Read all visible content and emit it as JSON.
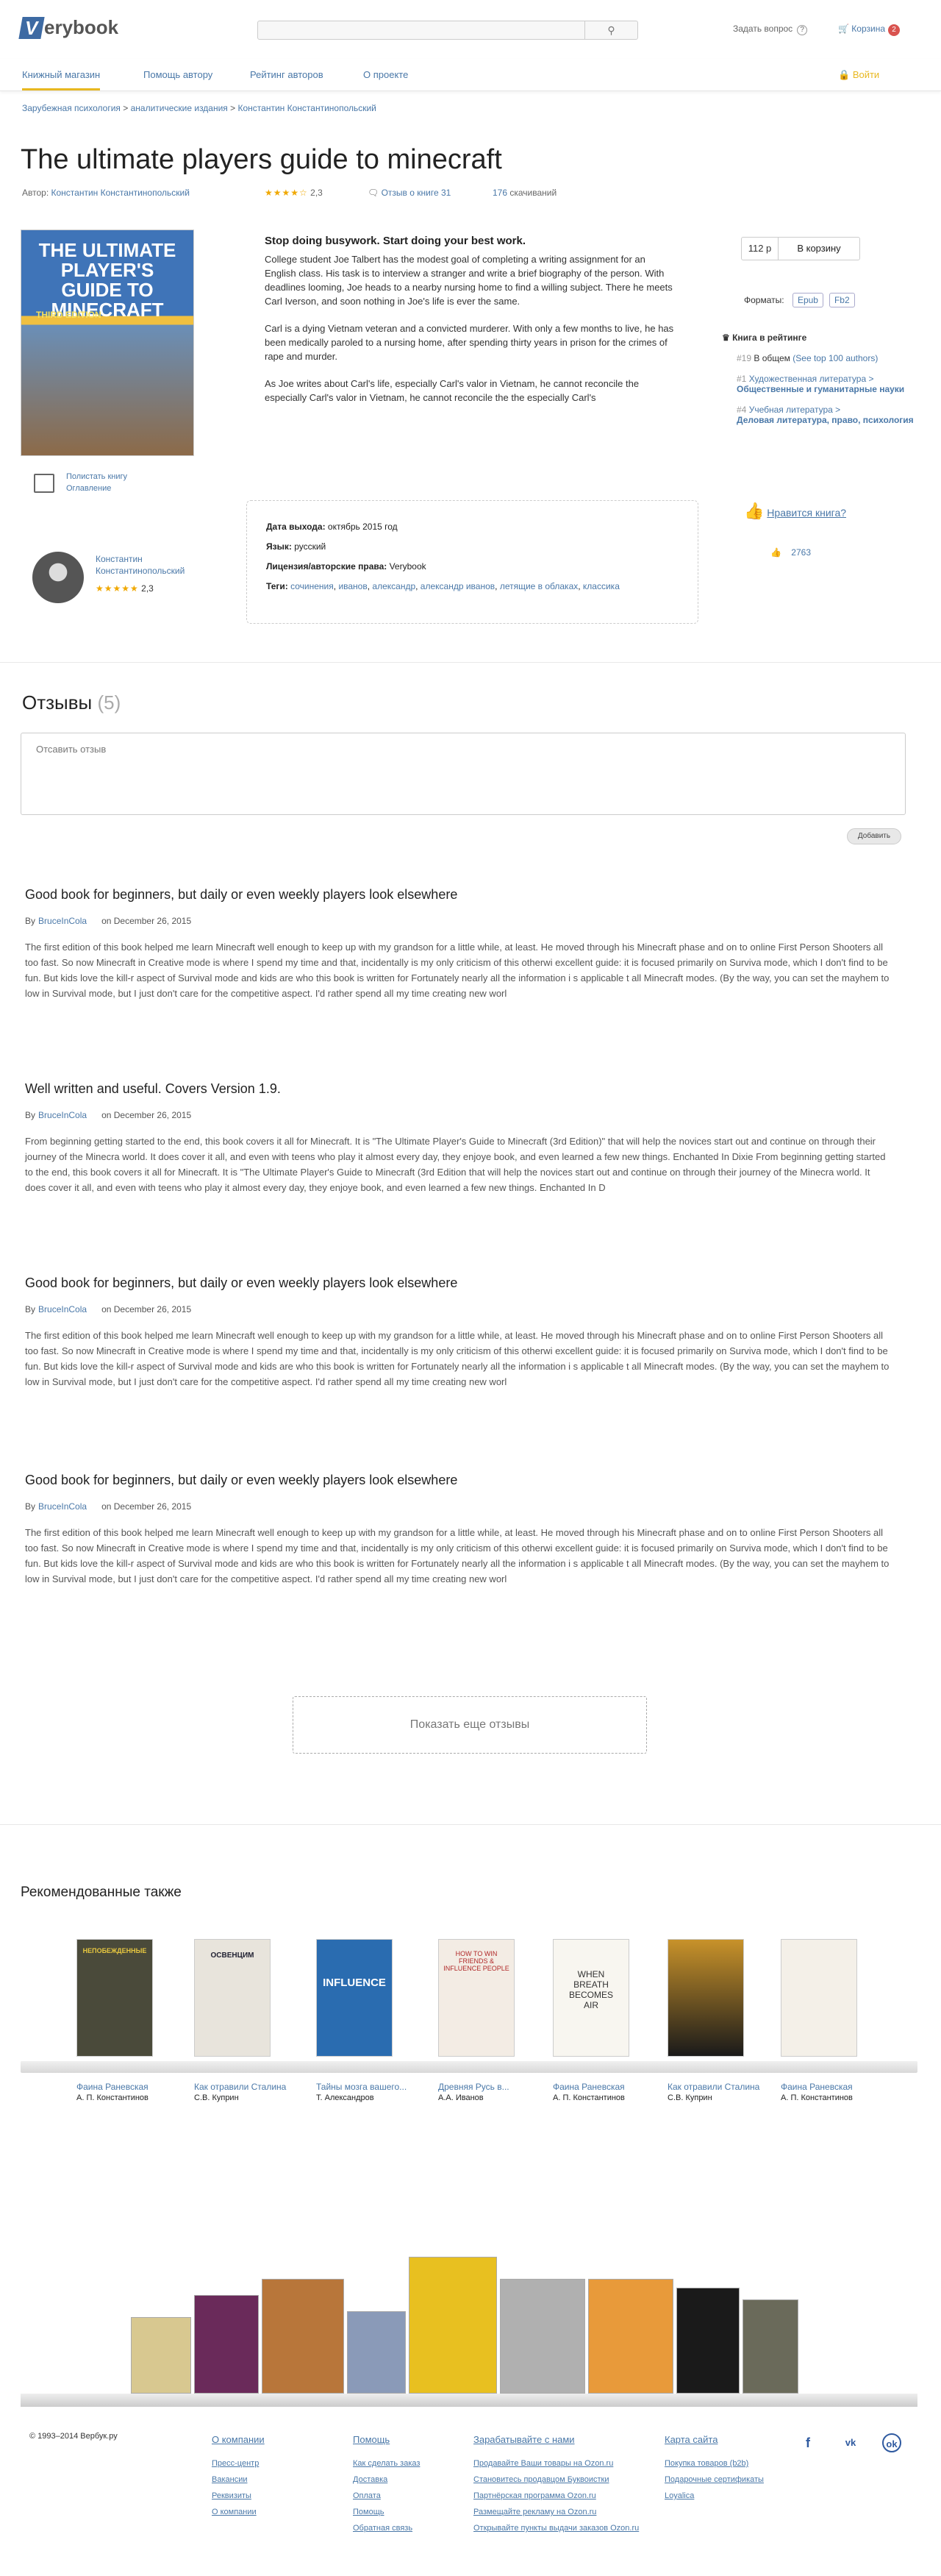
{
  "header": {
    "logo": "erybook",
    "search_icon": "search-icon",
    "ask": "Задать вопрос",
    "cart": "Корзина",
    "cart_count": "2"
  },
  "nav": {
    "items": [
      "Книжный магазин",
      "Помощь автору",
      "Рейтинг авторов",
      "О проекте"
    ],
    "login": "Войти"
  },
  "breadcrumb": [
    "Зарубежная психология",
    "аналитические издания",
    "Константин Константинопольский"
  ],
  "book": {
    "title": "The ultimate players guide to minecraft",
    "author_label": "Автор:",
    "author": "Константин Константинопольский",
    "rating": "2,3",
    "reviews": "Отзыв о книге 31",
    "downloads_n": "176",
    "downloads": "скачиваний",
    "cover_title": "THE ULTIMATE PLAYER'S GUIDE TO MINECRAFT",
    "cover_edition": "THIRD EDITION",
    "read_link": "Полистать книгу",
    "toc_link": "Оглавление",
    "author_name": "Константин Константинопольский",
    "author_rating": "2,3",
    "lead": "Stop doing busywork. Start doing your best work.",
    "p1": "College student Joe Talbert has the modest goal of completing a writing assignment for an English class. His task is to interview a stranger and write a brief biography of the person. With deadlines looming, Joe heads to a nearby nursing home to find a willing subject. There he meets Carl Iverson, and soon nothing in Joe's life is ever the same.",
    "p2": "Carl is a dying Vietnam veteran and a convicted murderer. With only a few months to live, he has been medically paroled to a nursing home, after spending thirty years in prison for the crimes of rape and murder.",
    "p3": "As Joe writes about Carl's life, especially Carl's valor in Vietnam, he cannot reconcile the especially Carl's valor in Vietnam, he cannot reconcile the the especially Carl's",
    "release_label": "Дата выхода:",
    "release": "октябрь 2015 год",
    "lang_label": "Язык:",
    "lang": "русский",
    "license_label": "Лицензия/авторские права:",
    "license": "Verybook",
    "tags_label": "Теги:",
    "tags": [
      "сочинения",
      "иванов",
      "александр",
      "александр иванов",
      "летящие в облаках",
      "классика"
    ],
    "price": "112 р",
    "buy": "В корзину",
    "formats_label": "Форматы:",
    "formats": [
      "Epub",
      "Fb2"
    ],
    "rating_h": "Книга в рейтинге",
    "r1n": "#19",
    "r1": "В общем",
    "r1l": "(See top 100 authors)",
    "r2n": "#1",
    "r2": "Художественная литература >",
    "r2b": "Общественные и гуманитарные науки",
    "r3n": "#4",
    "r3": "Учебная литература >",
    "r3b": "Деловая литература, право, психология",
    "like": "Нравится книга?",
    "likes": "2763"
  },
  "reviews": {
    "title": "Отзывы",
    "count": "(5)",
    "placeholder": "Отсавить отзыв",
    "add": "Добавить",
    "more": "Показать еще отзывы",
    "items": [
      {
        "title": "Good book for beginners, but daily or even weekly players look elsewhere",
        "by": "By",
        "user": "BruceInCola",
        "date": "on December 26, 2015",
        "body": "The first edition of this book helped me learn Minecraft well enough to keep up with my grandson for a little while, at least. He moved through his Minecraft phase and on to online First Person Shooters all too fast. So now Minecraft in Creative mode is where I spend my time and that, incidentally is my only criticism of this otherwi excellent guide: it is focused primarily on Surviva mode, which I don't find to be fun. But kids love the kill-r aspect of Survival mode and kids are who this book is written for Fortunately nearly all the information i s applicable t all Minecraft modes. (By the way, you can set the mayhem to low in Survival mode, but I just don't care for the competitive aspect. I'd rather spend all my time creating new worl"
      },
      {
        "title": "Well written and useful. Covers Version 1.9.",
        "by": "By",
        "user": "BruceInCola",
        "date": "on December 26, 2015",
        "body": "From beginning getting started to the end, this book covers it all for Minecraft. It is \"The Ultimate Player's Guide to Minecraft (3rd Edition)\" that will help the novices start out and continue on through their journey of the Minecra world. It does cover it all, and even with teens who play it almost every day, they enjoye book, and even learned a few new things. Enchanted In Dixie From beginning getting started to the end, this book covers it all for Minecraft. It is \"The Ultimate Player's Guide to Minecraft (3rd Edition that will help the novices start out and continue on through their journey of the Minecra world. It does cover it all, and even with teens who play it almost every day, they enjoye book, and even learned a few new things. Enchanted In D"
      },
      {
        "title": "Good book for beginners, but daily or even weekly players look elsewhere",
        "by": "By",
        "user": "BruceInCola",
        "date": "on December 26, 2015",
        "body": "The first edition of this book helped me learn Minecraft well enough to keep up with my grandson for a little while, at least. He moved through his Minecraft phase and on to online First Person Shooters all too fast. So now Minecraft in Creative mode is where I spend my time and that, incidentally is my only criticism of this otherwi excellent guide: it is focused primarily on Surviva mode, which I don't find to be fun. But kids love the kill-r aspect of Survival mode and kids are who this book is written for Fortunately nearly all the information i s applicable t all Minecraft modes. (By the way, you can set the mayhem to low in Survival mode, but I just don't care for the competitive aspect. I'd rather spend all my time creating new worl"
      },
      {
        "title": "Good book for beginners, but daily or even weekly players look elsewhere",
        "by": "By",
        "user": "BruceInCola",
        "date": "on December 26, 2015",
        "body": "The first edition of this book helped me learn Minecraft well enough to keep up with my grandson for a little while, at least. He moved through his Minecraft phase and on to online First Person Shooters all too fast. So now Minecraft in Creative mode is where I spend my time and that, incidentally is my only criticism of this otherwi excellent guide: it is focused primarily on Surviva mode, which I don't find to be fun. But kids love the kill-r aspect of Survival mode and kids are who this book is written for Fortunately nearly all the information i s applicable t all Minecraft modes. (By the way, you can set the mayhem to low in Survival mode, but I just don't care for the competitive aspect. I'd rather spend all my time creating new worl"
      }
    ]
  },
  "recommended": {
    "title": "Рекомендованные также",
    "items": [
      {
        "t": "Фаина Раневская",
        "a": "А. П. Константинов"
      },
      {
        "t": "Как отравили Сталина",
        "a": "С.В. Куприн"
      },
      {
        "t": "Тайны мозга вашего...",
        "a": "Т. Александров"
      },
      {
        "t": "Древняя Русь в...",
        "a": "А.А. Иванов"
      },
      {
        "t": "Фаина Раневская",
        "a": "А. П. Константинов"
      },
      {
        "t": "Как отравили Сталина",
        "a": "С.В. Куприн"
      },
      {
        "t": "Фаина Раневская",
        "a": "А. П. Константинов"
      }
    ],
    "covers": [
      "НЕПОБЕЖДЕННЫЕ",
      "ОСВЕНЦИМ",
      "INFLUENCE",
      "HOW TO WIN FRIENDS & INFLUENCE PEOPLE",
      "WHEN BREATH BECOMES AIR",
      "",
      ""
    ]
  },
  "footer": {
    "copy": "© 1993–2014 Вербук.ру",
    "col1": {
      "h": "О компании",
      "items": [
        "Пресс-центр",
        "Вакансии",
        "Реквизиты",
        "О компании"
      ]
    },
    "col2": {
      "h": "Помощь",
      "items": [
        "Как сделать заказ",
        "Доставка",
        "Оплата",
        "Помощь",
        "Обратная связь"
      ]
    },
    "col3": {
      "h": "Зарабатывайте с нами",
      "items": [
        "Продавайте Ваши товары на Ozon.ru",
        "Становитесь продавцом Буквоистки",
        "Партнёрская программа Ozon.ru",
        "Размещайте рекламу на Ozon.ru",
        "Открывайте пункты выдачи заказов Ozon.ru"
      ]
    },
    "col4": {
      "h": "Карта сайта",
      "items": [
        "Покупка товаров (b2b)",
        "Подарочные сертификаты",
        "Loyalica"
      ]
    },
    "social": [
      "f",
      "vk",
      "ok"
    ]
  }
}
